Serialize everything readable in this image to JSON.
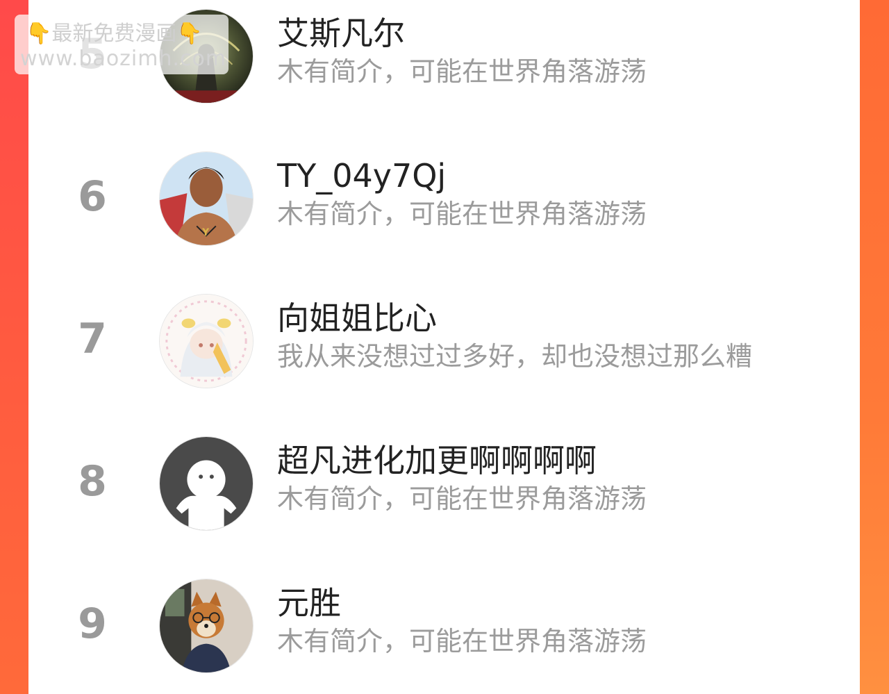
{
  "watermark": {
    "left_icon": "pointing-down-hand-icon",
    "text": "最新免费漫画",
    "right_icon": "pointing-down-hand-icon",
    "url": "www.baozimh.com"
  },
  "list": [
    {
      "rank": "5",
      "name": "艾斯凡尔",
      "bio": "木有简介，可能在世界角落游荡",
      "avatar": "dark-warrior-avatar"
    },
    {
      "rank": "6",
      "name": "TY_04y7Qj",
      "bio": "木有简介，可能在世界角落游荡",
      "avatar": "man-portrait-avatar"
    },
    {
      "rank": "7",
      "name": "向姐姐比心",
      "bio": "我从来没想过过多好，却也没想过那么糟",
      "avatar": "anime-girl-avatar"
    },
    {
      "rank": "8",
      "name": "超凡进化加更啊啊啊啊",
      "bio": "木有简介，可能在世界角落游荡",
      "avatar": "default-user-avatar"
    },
    {
      "rank": "9",
      "name": "元胜",
      "bio": "木有简介，可能在世界角落游荡",
      "avatar": "shiba-dog-avatar"
    }
  ]
}
